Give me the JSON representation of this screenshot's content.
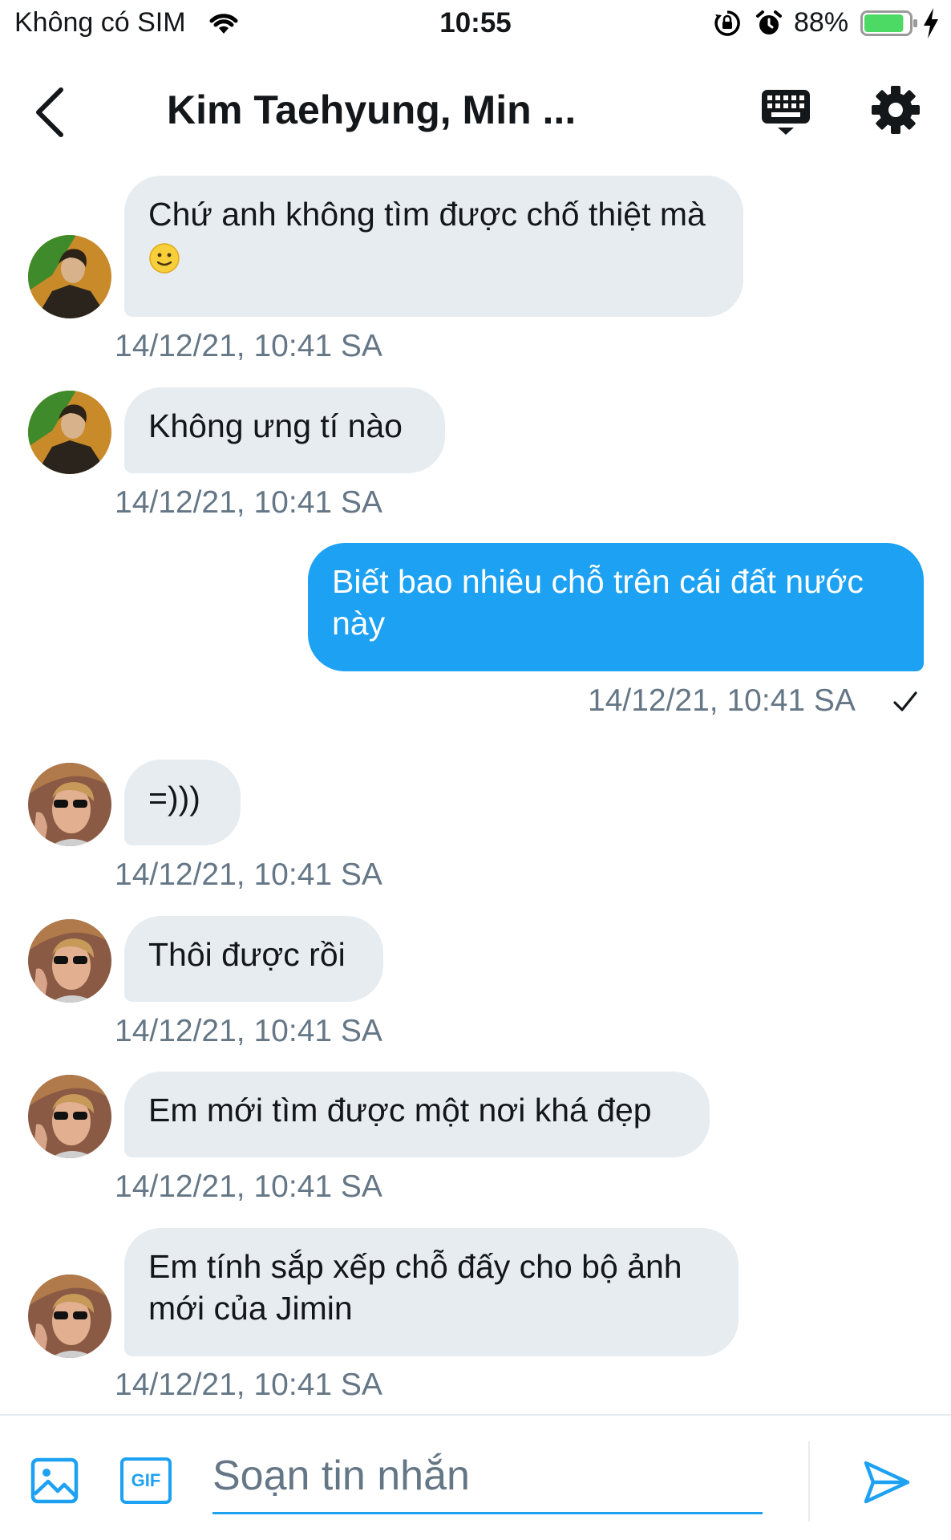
{
  "status_bar": {
    "carrier": "Không có SIM",
    "time": "10:55",
    "battery": "88%",
    "battery_level": 0.88,
    "battery_color": "#4cd964"
  },
  "header": {
    "title": "Kim Taehyung, Min ...",
    "back_icon": "chevron-left-icon",
    "keyboard_icon": "keyboard-icon",
    "settings_icon": "gear-icon"
  },
  "colors": {
    "accent": "#1da1f2",
    "incoming_bubble": "#e6ecf0",
    "timestamp": "#657786"
  },
  "messages": [
    {
      "direction": "in",
      "sender_avatar": "avatar-1",
      "text": "Chứ anh không tìm được chố thiệt mà",
      "emoji": "slightly-smiling-face-icon",
      "timestamp": "14/12/21, 10:41 SA"
    },
    {
      "direction": "in",
      "sender_avatar": "avatar-1",
      "text": "Không ưng tí nào",
      "timestamp": "14/12/21, 10:41 SA"
    },
    {
      "direction": "out",
      "text": "Biết bao nhiêu chỗ trên cái đất nước này",
      "timestamp": "14/12/21, 10:41 SA",
      "status_icon": "checkmark-icon"
    },
    {
      "direction": "in",
      "sender_avatar": "avatar-2",
      "text": "=)))",
      "timestamp": "14/12/21, 10:41 SA"
    },
    {
      "direction": "in",
      "sender_avatar": "avatar-2",
      "text": "Thôi được rồi",
      "timestamp": "14/12/21, 10:41 SA"
    },
    {
      "direction": "in",
      "sender_avatar": "avatar-2",
      "text": "Em mới tìm được một nơi khá đẹp",
      "timestamp": "14/12/21, 10:41 SA"
    },
    {
      "direction": "in",
      "sender_avatar": "avatar-2",
      "text": "Em tính sắp xếp chỗ đấy cho bộ ảnh mới của Jimin",
      "timestamp": "14/12/21, 10:41 SA"
    }
  ],
  "composer": {
    "image_icon": "image-icon",
    "gif_label": "GIF",
    "placeholder": "Soạn tin nhắn",
    "send_icon": "send-icon"
  }
}
